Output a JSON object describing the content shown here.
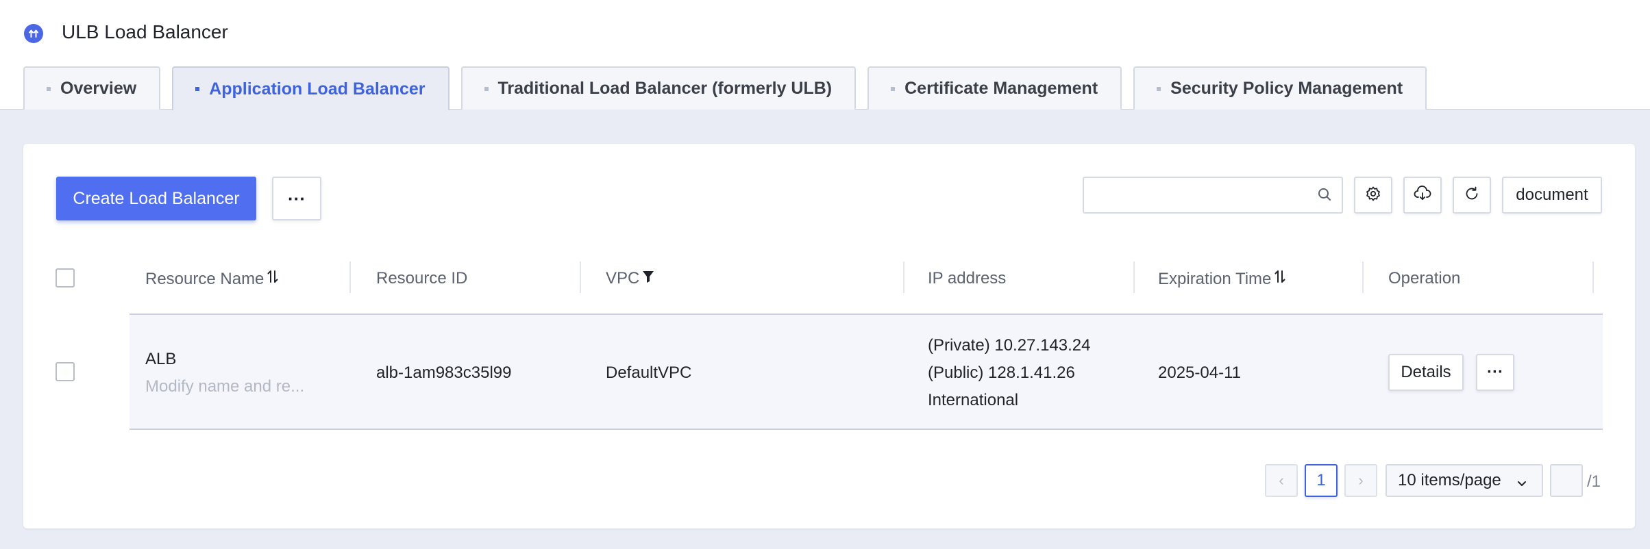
{
  "app": {
    "title": "ULB Load Balancer"
  },
  "tabs": [
    {
      "label": "Overview",
      "active": false
    },
    {
      "label": "Application Load Balancer",
      "active": true
    },
    {
      "label": "Traditional Load Balancer (formerly ULB)",
      "active": false
    },
    {
      "label": "Certificate Management",
      "active": false
    },
    {
      "label": "Security Policy Management",
      "active": false
    }
  ],
  "toolbar": {
    "create_label": "Create Load Balancer",
    "more_label": "···",
    "search_placeholder": "",
    "document_label": "document",
    "icons": [
      "settings-icon",
      "cloud-download-icon",
      "refresh-icon"
    ]
  },
  "table": {
    "columns": [
      "Resource Name",
      "Resource ID",
      "VPC",
      "IP address",
      "Expiration Time",
      "Operation"
    ],
    "rows": [
      {
        "name": "ALB",
        "name_sub": "Modify name and re...",
        "id": "alb-1am983c35l99",
        "vpc": "DefaultVPC",
        "ip_private": "(Private) 10.27.143.24",
        "ip_public": "(Public) 128.1.41.26",
        "ip_region": "International",
        "expiration": "2025-04-11",
        "details_label": "Details",
        "more_label": "···"
      }
    ]
  },
  "pagination": {
    "prev": "‹",
    "next": "›",
    "current": "1",
    "page_size": "10 items/page",
    "total": "/1"
  },
  "colors": {
    "accent": "#4f6ef0",
    "active_tab": "#3e63dd",
    "background": "#e9ecf4"
  }
}
